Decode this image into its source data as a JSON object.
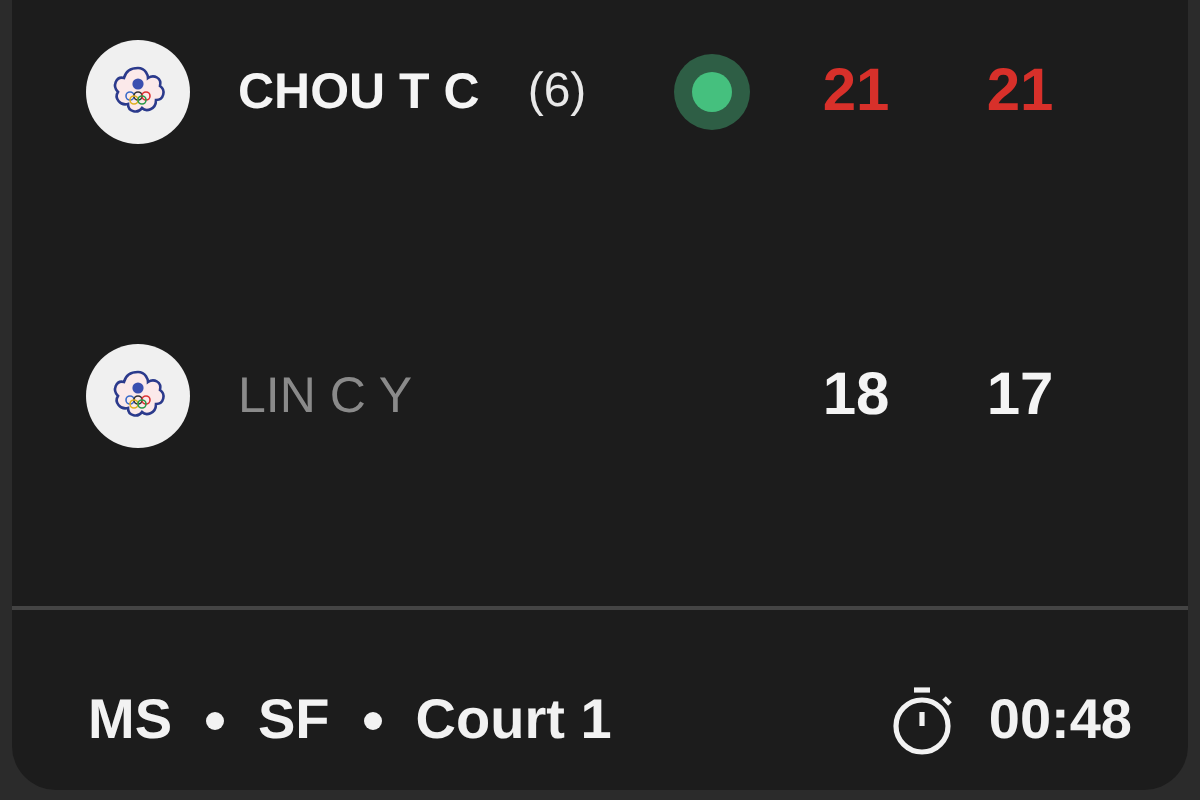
{
  "players": [
    {
      "name": "CHOU T C",
      "seed": "(6)",
      "winner": true,
      "serving": true,
      "scores": [
        {
          "value": "21",
          "won": true
        },
        {
          "value": "21",
          "won": true
        }
      ]
    },
    {
      "name": "LIN C Y",
      "winner": false,
      "serving": false,
      "scores": [
        {
          "value": "18",
          "won": false
        },
        {
          "value": "17",
          "won": false
        }
      ]
    }
  ],
  "footer": {
    "info": [
      "MS",
      "SF",
      "Court 1"
    ],
    "duration": "00:48"
  }
}
